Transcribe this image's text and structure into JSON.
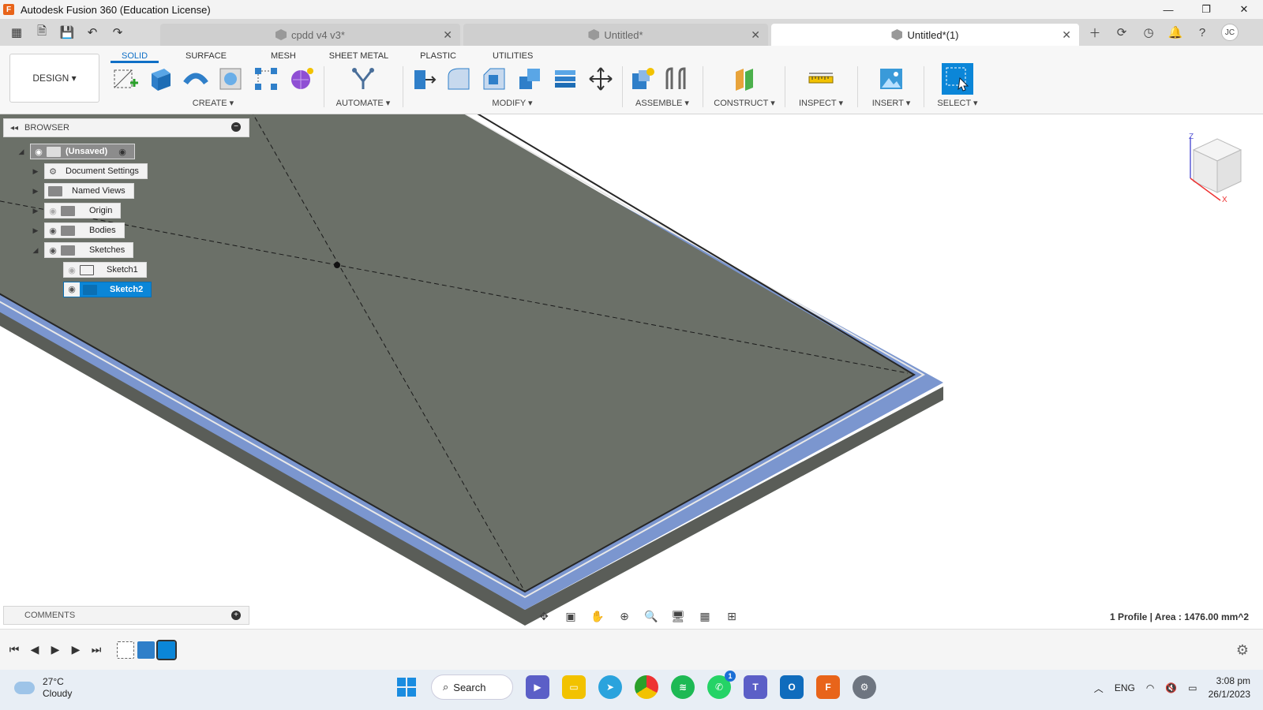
{
  "window": {
    "title": "Autodesk Fusion 360 (Education License)",
    "logo_letter": "F"
  },
  "tabs": [
    {
      "label": "cpdd v4 v3*",
      "active": false
    },
    {
      "label": "Untitled*",
      "active": false
    },
    {
      "label": "Untitled*(1)",
      "active": true
    }
  ],
  "user_initials": "JC",
  "ribbon": {
    "workspace": "DESIGN ▾",
    "workspace_tabs": [
      "SOLID",
      "SURFACE",
      "MESH",
      "SHEET METAL",
      "PLASTIC",
      "UTILITIES"
    ],
    "groups": {
      "create": "CREATE ▾",
      "automate": "AUTOMATE ▾",
      "modify": "MODIFY ▾",
      "assemble": "ASSEMBLE ▾",
      "construct": "CONSTRUCT ▾",
      "inspect": "INSPECT ▾",
      "insert": "INSERT ▾",
      "select": "SELECT ▾"
    }
  },
  "browser": {
    "title": "BROWSER",
    "nodes": {
      "root": "(Unsaved)",
      "document_settings": "Document Settings",
      "named_views": "Named Views",
      "origin": "Origin",
      "bodies": "Bodies",
      "sketches": "Sketches",
      "sketch1": "Sketch1",
      "sketch2": "Sketch2"
    }
  },
  "comments": {
    "title": "COMMENTS"
  },
  "status": {
    "profile_readout": "1 Profile | Area : 1476.00 mm^2"
  },
  "taskbar": {
    "weather_temp": "27°C",
    "weather_desc": "Cloudy",
    "search_label": "Search",
    "language": "ENG",
    "time": "3:08 pm",
    "date": "26/1/2023",
    "whatsapp_badge": "1"
  },
  "colors": {
    "accent": "#0f6fc6",
    "selection": "#0b86d8",
    "plate_face": "#6b7068",
    "plate_rim": "#7b96cf",
    "fusion_orange": "#e8641a"
  }
}
